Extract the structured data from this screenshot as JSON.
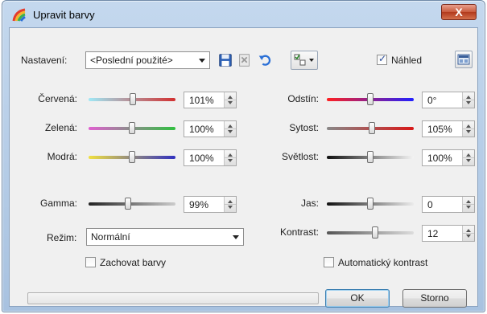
{
  "window": {
    "title": "Upravit barvy",
    "close_glyph": "X"
  },
  "toolbar": {
    "preset_label": "Nastavení:",
    "preset_value": "<Poslední použité>",
    "preview_label": "Náhled",
    "preview_checked": true,
    "icons": [
      "save-icon",
      "delete-icon",
      "undo-icon",
      "options-icon",
      "layout-icon"
    ]
  },
  "sliders_left": [
    {
      "label": "Červená:",
      "value": "101%",
      "level": 0.505,
      "gradient": [
        "#9fe8f6",
        "#d23030"
      ]
    },
    {
      "label": "Zelená:",
      "value": "100%",
      "level": 0.5,
      "gradient": [
        "#e060d0",
        "#30c040"
      ]
    },
    {
      "label": "Modrá:",
      "value": "100%",
      "level": 0.5,
      "gradient": [
        "#f0e040",
        "#3030c0"
      ]
    },
    {
      "label": "Gamma:",
      "value": "99%",
      "level": 0.45,
      "gradient": [
        "#222222",
        "#cccccc"
      ]
    }
  ],
  "sliders_right": [
    {
      "label": "Odstín:",
      "value": "0°",
      "level": 0.5,
      "gradient": [
        "#ff2020",
        "#2020ff"
      ]
    },
    {
      "label": "Sytost:",
      "value": "105%",
      "level": 0.52,
      "gradient": [
        "#888888",
        "#d81818"
      ]
    },
    {
      "label": "Světlost:",
      "value": "100%",
      "level": 0.5,
      "gradient": [
        "#111111",
        "#f4f4f4"
      ]
    },
    {
      "label": "Jas:",
      "value": "0",
      "level": 0.5,
      "gradient": [
        "#111111",
        "#ebebeb"
      ]
    },
    {
      "label": "Kontrast:",
      "value": "12",
      "level": 0.56,
      "gradient": [
        "#555555",
        "#dddddd"
      ]
    }
  ],
  "mode": {
    "label": "Režim:",
    "value": "Normální"
  },
  "keep_colors": {
    "label": "Zachovat barvy",
    "checked": false
  },
  "auto_contrast": {
    "label": "Automatický kontrast",
    "checked": false
  },
  "buttons": {
    "ok": "OK",
    "cancel": "Storno"
  }
}
